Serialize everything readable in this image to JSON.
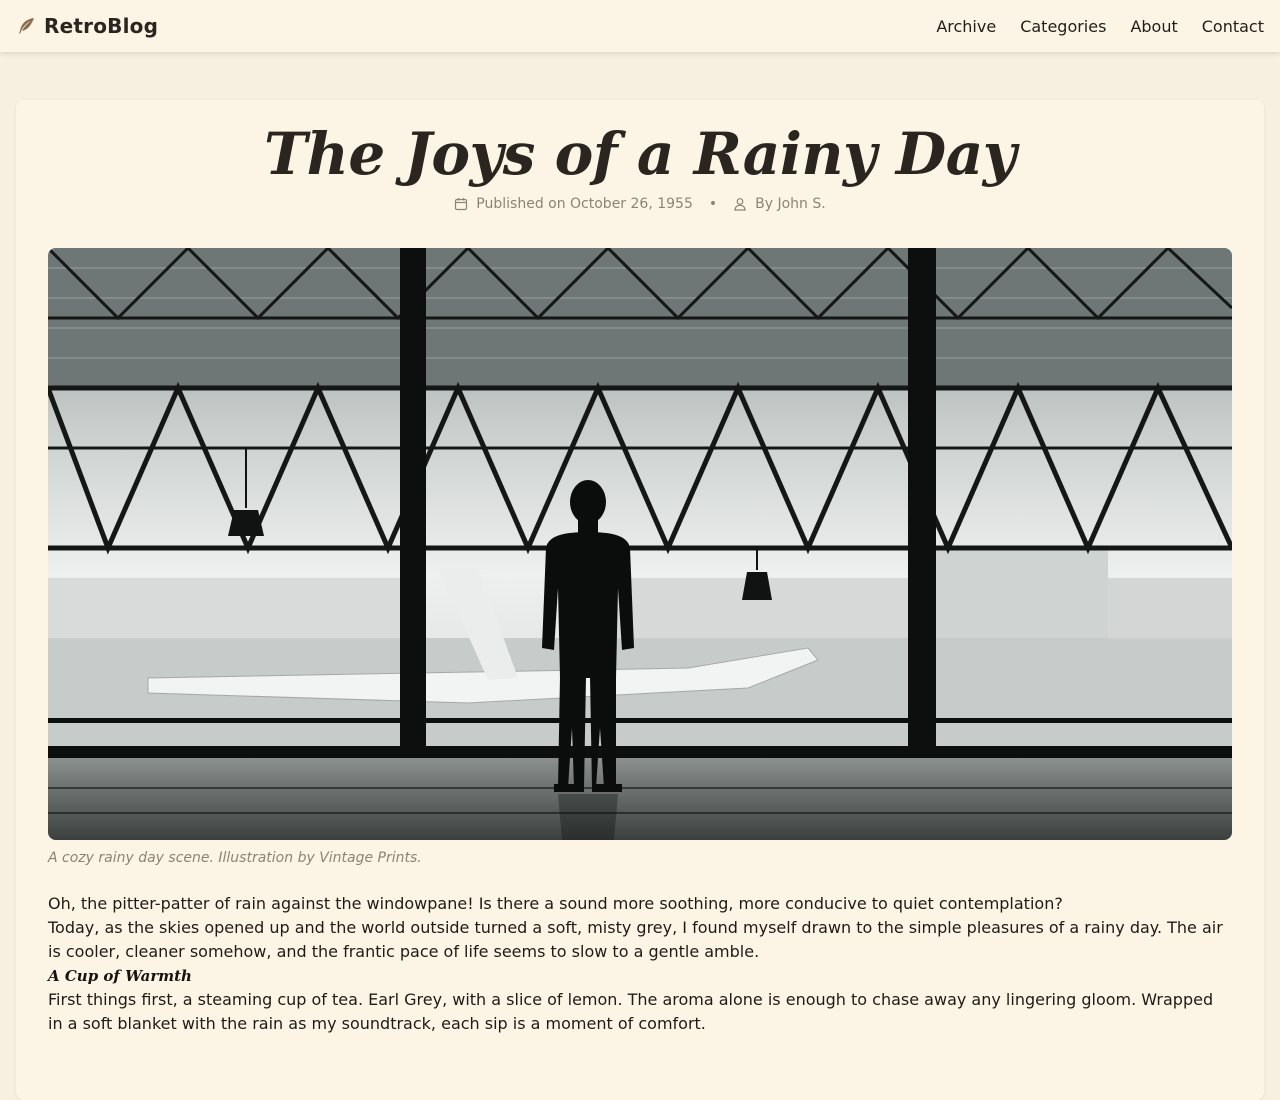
{
  "header": {
    "brand": "RetroBlog",
    "brand_icon": "feather-icon",
    "nav": [
      "Archive",
      "Categories",
      "About",
      "Contact"
    ]
  },
  "post": {
    "title": "The Joys of a Rainy Day",
    "published": "Published on October 26, 1955",
    "author": "By John S.",
    "image_caption": "A cozy rainy day scene. Illustration by Vintage Prints.",
    "paragraphs": [
      "Oh, the pitter-patter of rain against the windowpane! Is there a sound more soothing, more conducive to quiet contemplation?",
      "Today, as the skies opened up and the world outside turned a soft, misty grey, I found myself drawn to the simple pleasures of a rainy day. The air is cooler, cleaner somehow, and the frantic pace of life seems to slow to a gentle amble."
    ],
    "subheading": "A Cup of Warmth",
    "paragraph_after": "First things first, a steaming cup of tea. Earl Grey, with a slice of lemon. The aroma alone is enough to chase away any lingering gloom. Wrapped in a soft blanket with the rain as my soundtrack, each sip is a moment of comfort."
  },
  "colors": {
    "page_bg": "#f7efe0",
    "card_bg": "#fcf5e6",
    "muted_text": "#8c8377",
    "brand_icon": "#8b6b4f"
  }
}
